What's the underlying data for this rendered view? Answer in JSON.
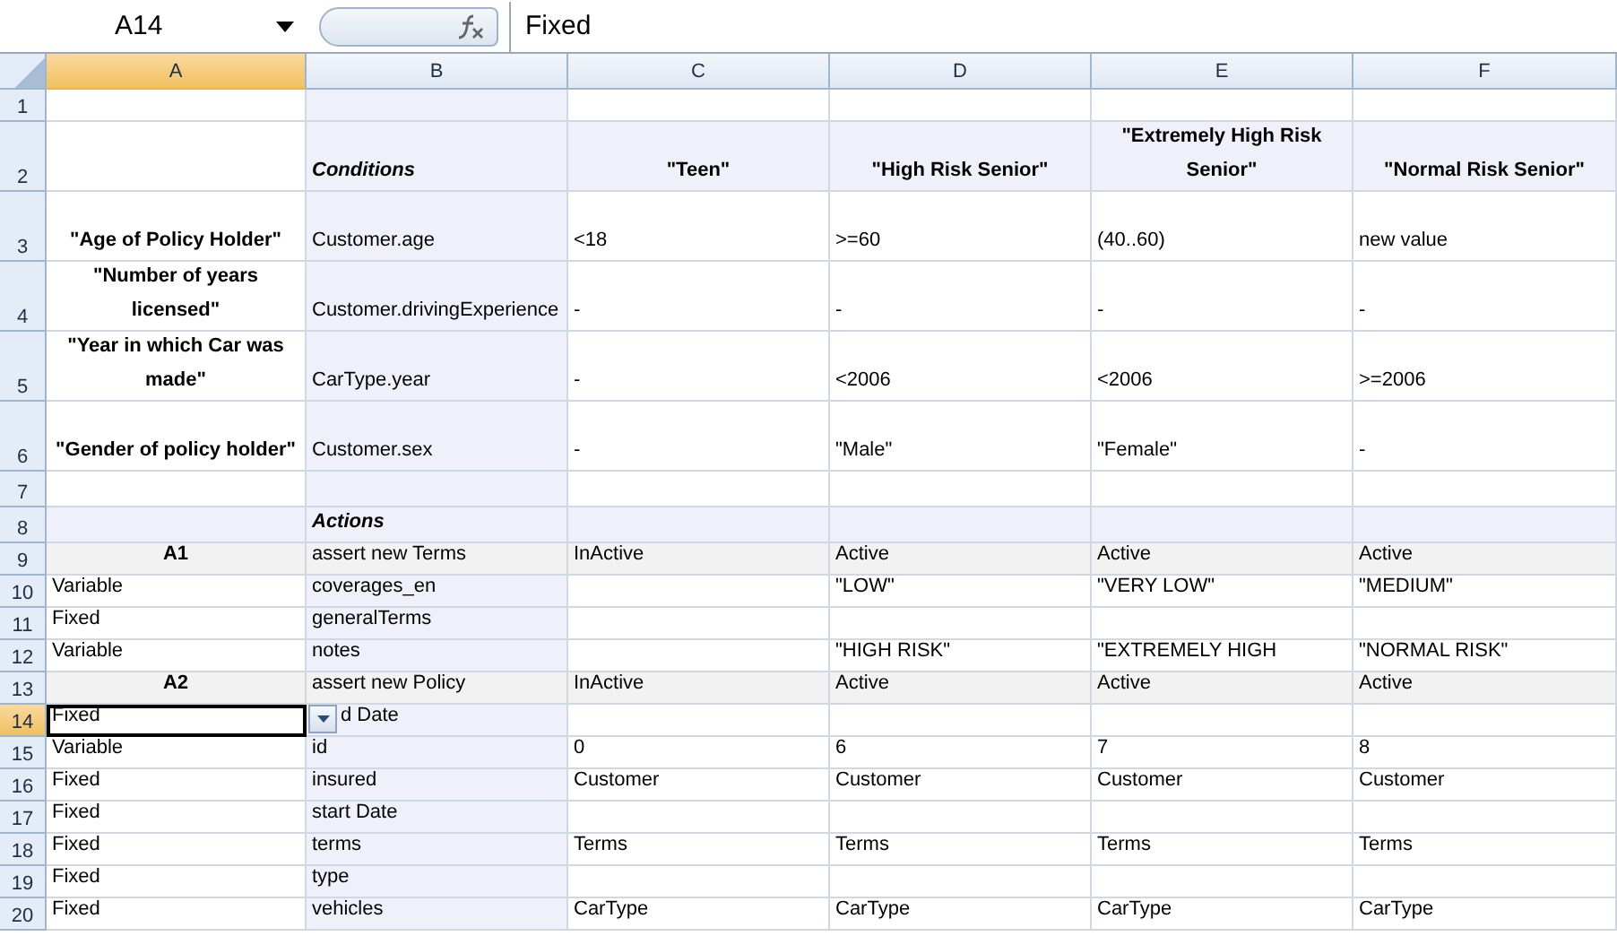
{
  "formula_bar": {
    "name_box": "A14",
    "formula": "Fixed"
  },
  "columns": [
    {
      "label": "A",
      "selected": true
    },
    {
      "label": "B",
      "selected": false
    },
    {
      "label": "C",
      "selected": false
    },
    {
      "label": "D",
      "selected": false
    },
    {
      "label": "E",
      "selected": false
    },
    {
      "label": "F",
      "selected": false
    }
  ],
  "rows": [
    {
      "label": "1",
      "kind": "blank",
      "selected": false,
      "cells": {}
    },
    {
      "label": "2",
      "kind": "heading",
      "selected": false,
      "cells": {
        "B": "Conditions",
        "C": "\"Teen\"",
        "D": "\"High Risk Senior\"",
        "E": "\"Extremely High Risk Senior\"",
        "F": "\"Normal Risk Senior\""
      }
    },
    {
      "label": "3",
      "kind": "condition",
      "selected": false,
      "cells": {
        "A": "\"Age of Policy Holder\"",
        "B": "Customer.age",
        "C": "<18",
        "D": ">=60",
        "E": "(40..60)",
        "F": "new value"
      }
    },
    {
      "label": "4",
      "kind": "condition",
      "selected": false,
      "cells": {
        "A": "\"Number of years licensed\"",
        "B": "Customer.drivingExperience",
        "C": "-",
        "D": "-",
        "E": "-",
        "F": "-"
      }
    },
    {
      "label": "5",
      "kind": "condition",
      "selected": false,
      "cells": {
        "A": "\"Year in which Car was made\"",
        "B": "CarType.year",
        "C": "-",
        "D": "<2006",
        "E": "<2006",
        "F": ">=2006"
      }
    },
    {
      "label": "6",
      "kind": "condition",
      "selected": false,
      "cells": {
        "A": "\"Gender of policy holder\"",
        "B": "Customer.sex",
        "C": "-",
        "D": "\"Male\"",
        "E": "\"Female\"",
        "F": "-"
      }
    },
    {
      "label": "7",
      "kind": "spacer",
      "selected": false,
      "cells": {}
    },
    {
      "label": "8",
      "kind": "section",
      "selected": false,
      "cells": {
        "B": "Actions"
      }
    },
    {
      "label": "9",
      "kind": "action",
      "selected": false,
      "cells": {
        "A": "A1",
        "B": "assert new Terms",
        "C": "InActive",
        "D": "Active",
        "E": "Active",
        "F": "Active"
      }
    },
    {
      "label": "10",
      "kind": "field",
      "selected": false,
      "cells": {
        "A": "Variable",
        "B": "coverages_en",
        "D": "\"LOW\"",
        "E": "\"VERY LOW\"",
        "F": "\"MEDIUM\""
      }
    },
    {
      "label": "11",
      "kind": "field",
      "selected": false,
      "cells": {
        "A": "Fixed",
        "B": "generalTerms"
      }
    },
    {
      "label": "12",
      "kind": "field",
      "selected": false,
      "cells": {
        "A": "Variable",
        "B": "notes",
        "D": "\"HIGH RISK\"",
        "E": "\"EXTREMELY HIGH",
        "F": "\"NORMAL RISK\""
      }
    },
    {
      "label": "13",
      "kind": "action",
      "selected": false,
      "cells": {
        "A": "A2",
        "B": "assert new Policy",
        "C": "InActive",
        "D": "Active",
        "E": "Active",
        "F": "Active"
      }
    },
    {
      "label": "14",
      "kind": "field",
      "selected": true,
      "cells": {
        "A": "Fixed",
        "B": "d Date"
      }
    },
    {
      "label": "15",
      "kind": "field",
      "selected": false,
      "cells": {
        "A": "Variable",
        "B": "id",
        "C": "0",
        "D": "6",
        "E": "7",
        "F": "8"
      }
    },
    {
      "label": "16",
      "kind": "field",
      "selected": false,
      "cells": {
        "A": "Fixed",
        "B": "insured",
        "C": "Customer",
        "D": "Customer",
        "E": "Customer",
        "F": "Customer"
      }
    },
    {
      "label": "17",
      "kind": "field",
      "selected": false,
      "cells": {
        "A": "Fixed",
        "B": "start Date"
      }
    },
    {
      "label": "18",
      "kind": "field",
      "selected": false,
      "cells": {
        "A": "Fixed",
        "B": "terms",
        "C": "Terms",
        "D": "Terms",
        "E": "Terms",
        "F": "Terms"
      }
    },
    {
      "label": "19",
      "kind": "field",
      "selected": false,
      "cells": {
        "A": "Fixed",
        "B": "type"
      }
    },
    {
      "label": "20",
      "kind": "field",
      "selected": false,
      "cells": {
        "A": "Fixed",
        "B": "vehicles",
        "C": "CarType",
        "D": "CarType",
        "E": "CarType",
        "F": "CarType"
      }
    }
  ]
}
